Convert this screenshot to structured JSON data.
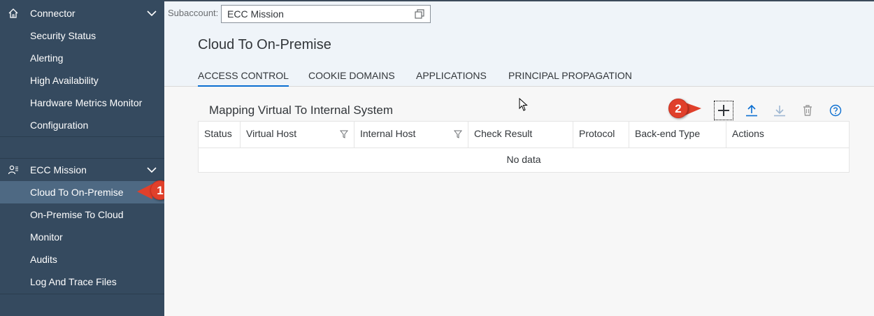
{
  "sidebar": {
    "connector_group": {
      "label": "Connector",
      "icon": "home-icon"
    },
    "connector_items": [
      {
        "label": "Security Status"
      },
      {
        "label": "Alerting"
      },
      {
        "label": "High Availability"
      },
      {
        "label": "Hardware Metrics Monitor"
      },
      {
        "label": "Configuration"
      }
    ],
    "mission_group": {
      "label": "ECC Mission",
      "icon": "person-settings-icon"
    },
    "mission_items": [
      {
        "label": "Cloud To On-Premise",
        "selected": true
      },
      {
        "label": "On-Premise To Cloud"
      },
      {
        "label": "Monitor"
      },
      {
        "label": "Audits"
      },
      {
        "label": "Log And Trace Files"
      }
    ]
  },
  "topbar": {
    "subaccount_label": "Subaccount:",
    "subaccount_value": "ECC Mission"
  },
  "page": {
    "title": "Cloud To On-Premise",
    "tabs": [
      {
        "label": "ACCESS CONTROL",
        "active": true
      },
      {
        "label": "COOKIE DOMAINS"
      },
      {
        "label": "APPLICATIONS"
      },
      {
        "label": "PRINCIPAL PROPAGATION"
      }
    ]
  },
  "table": {
    "title": "Mapping Virtual To Internal System",
    "columns": [
      {
        "label": "Status"
      },
      {
        "label": "Virtual Host",
        "filter": true
      },
      {
        "label": "Internal Host",
        "filter": true
      },
      {
        "label": "Check Result"
      },
      {
        "label": "Protocol"
      },
      {
        "label": "Back-end Type"
      },
      {
        "label": "Actions"
      }
    ],
    "empty_text": "No data"
  },
  "toolbar": {
    "buttons": [
      "add-icon",
      "upload-icon",
      "download-icon",
      "delete-icon",
      "help-icon"
    ]
  },
  "callouts": {
    "one": "1",
    "two": "2"
  },
  "colors": {
    "sidebar_bg": "#354a5f",
    "sidebar_selected": "#4e6983",
    "accent": "#0a6ed1",
    "callout": "#e0402b"
  }
}
